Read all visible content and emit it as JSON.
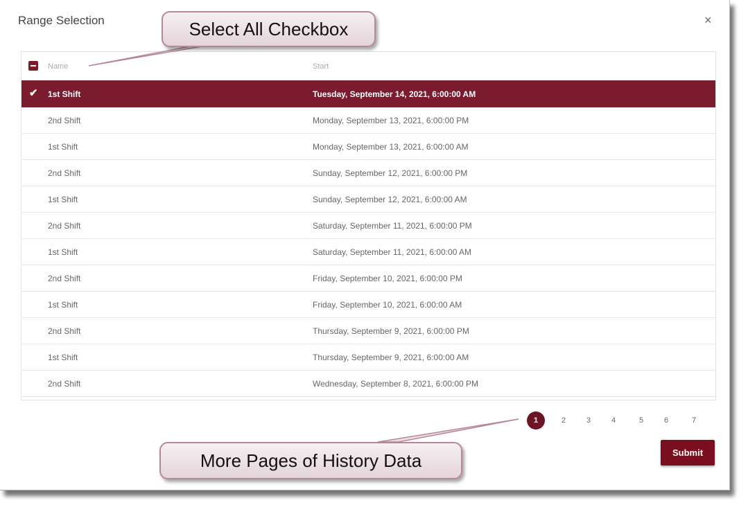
{
  "dialog": {
    "title": "Range Selection",
    "close_label": "×"
  },
  "table": {
    "columns": [
      "Name",
      "Start"
    ],
    "rows": [
      {
        "name": "1st Shift",
        "start": "Tuesday, September 14, 2021, 6:00:00 AM",
        "selected": true
      },
      {
        "name": "2nd Shift",
        "start": "Monday, September 13, 2021, 6:00:00 PM",
        "selected": false
      },
      {
        "name": "1st Shift",
        "start": "Monday, September 13, 2021, 6:00:00 AM",
        "selected": false
      },
      {
        "name": "2nd Shift",
        "start": "Sunday, September 12, 2021, 6:00:00 PM",
        "selected": false
      },
      {
        "name": "1st Shift",
        "start": "Sunday, September 12, 2021, 6:00:00 AM",
        "selected": false
      },
      {
        "name": "2nd Shift",
        "start": "Saturday, September 11, 2021, 6:00:00 PM",
        "selected": false
      },
      {
        "name": "1st Shift",
        "start": "Saturday, September 11, 2021, 6:00:00 AM",
        "selected": false
      },
      {
        "name": "2nd Shift",
        "start": "Friday, September 10, 2021, 6:00:00 PM",
        "selected": false
      },
      {
        "name": "1st Shift",
        "start": "Friday, September 10, 2021, 6:00:00 AM",
        "selected": false
      },
      {
        "name": "2nd Shift",
        "start": "Thursday, September 9, 2021, 6:00:00 PM",
        "selected": false
      },
      {
        "name": "1st Shift",
        "start": "Thursday, September 9, 2021, 6:00:00 AM",
        "selected": false
      },
      {
        "name": "2nd Shift",
        "start": "Wednesday, September 8, 2021, 6:00:00 PM",
        "selected": false
      }
    ]
  },
  "pagination": {
    "pages": [
      "1",
      "2",
      "3",
      "4",
      "5",
      "6",
      "7"
    ],
    "current": "1"
  },
  "submit_label": "Submit",
  "callouts": {
    "select_all": "Select All Checkbox",
    "more_pages": "More Pages of History Data"
  },
  "colors": {
    "accent": "#7a1b2e",
    "submit": "#7a0f1f"
  }
}
